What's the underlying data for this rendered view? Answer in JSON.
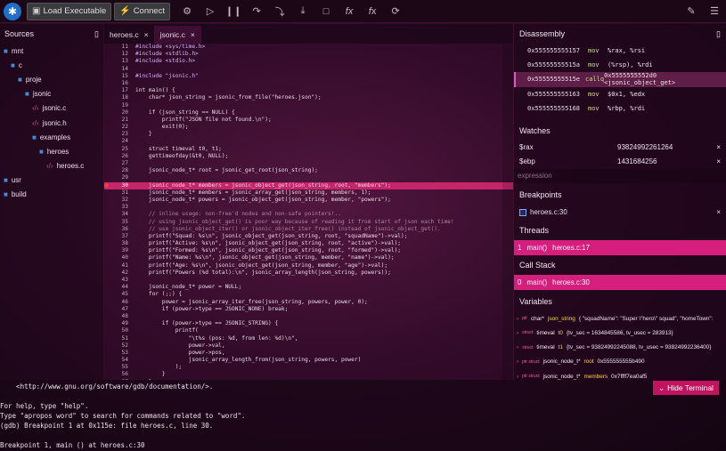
{
  "toolbar": {
    "load_label": "Load Executable",
    "connect_label": "Connect",
    "icons": [
      "cpu-icon",
      "play-icon",
      "pause-icon",
      "step-over-icon",
      "step-into-icon",
      "step-out-icon",
      "stop-icon",
      "function-icon",
      "function-alt-icon",
      "refresh-icon"
    ]
  },
  "sources": {
    "title": "Sources",
    "items": [
      {
        "label": "mnt",
        "kind": "folder",
        "depth": 0
      },
      {
        "label": "c",
        "kind": "folder",
        "depth": 1
      },
      {
        "label": "proje",
        "kind": "folder",
        "depth": 2
      },
      {
        "label": "jsonic",
        "kind": "folder",
        "depth": 3
      },
      {
        "label": "jsonic.c",
        "kind": "file",
        "depth": 4
      },
      {
        "label": "jsonic.h",
        "kind": "file",
        "depth": 4
      },
      {
        "label": "examples",
        "kind": "folder",
        "depth": 4
      },
      {
        "label": "heroes",
        "kind": "folder",
        "depth": 5
      },
      {
        "label": "heroes.c",
        "kind": "file",
        "depth": 6
      },
      {
        "label": "usr",
        "kind": "folder",
        "depth": 0
      },
      {
        "label": "build",
        "kind": "folder",
        "depth": 0
      }
    ]
  },
  "editor": {
    "tabs": [
      {
        "label": "heroes.c"
      },
      {
        "label": "jsonic.c"
      }
    ],
    "lines": [
      {
        "n": "11",
        "t": "#include <sys/time.h>"
      },
      {
        "n": "12",
        "t": "#include <stdlib.h>"
      },
      {
        "n": "13",
        "t": "#include <stdio.h>"
      },
      {
        "n": "14",
        "t": ""
      },
      {
        "n": "15",
        "t": "#include \"jsonic.h\""
      },
      {
        "n": "16",
        "t": ""
      },
      {
        "n": "17",
        "t": "int main() {"
      },
      {
        "n": "18",
        "t": "    char* json_string = jsonic_from_file(\"heroes.json\");"
      },
      {
        "n": "19",
        "t": ""
      },
      {
        "n": "20",
        "t": "    if (json_string == NULL) {"
      },
      {
        "n": "21",
        "t": "        printf(\"JSON file not found.\\n\");"
      },
      {
        "n": "22",
        "t": "        exit(0);"
      },
      {
        "n": "23",
        "t": "    }"
      },
      {
        "n": "24",
        "t": ""
      },
      {
        "n": "25",
        "t": "    struct timeval t0, t1;"
      },
      {
        "n": "26",
        "t": "    gettimeofday(&t0, NULL);"
      },
      {
        "n": "27",
        "t": ""
      },
      {
        "n": "28",
        "t": "    jsonic_node_t* root = jsonic_get_root(json_string);"
      },
      {
        "n": "29",
        "t": ""
      },
      {
        "n": "30",
        "t": "    jsonic_node_t* members = jsonic_object_get(json_string, root, \"members\");",
        "hl": true,
        "bp": true
      },
      {
        "n": "31",
        "t": "    jsonic_node_t* members = jsonic_array_get(json_string, members, 1);"
      },
      {
        "n": "32",
        "t": "    jsonic_node_t* powers = jsonic_object_get(json_string, member, \"powers\");"
      },
      {
        "n": "33",
        "t": ""
      },
      {
        "n": "34",
        "t": "    // inline usage: non-free'd nodes and non-safe pointers!.."
      },
      {
        "n": "35",
        "t": "    // using jsonic_object_get() is poor way because of reading it from start of json each time!"
      },
      {
        "n": "36",
        "t": "    // use jsonic_object_iter() or jsonic_object_iter_free() instead of jsonic_object_get()."
      },
      {
        "n": "37",
        "t": "    printf(\"Squad: %s\\n\", jsonic_object_get(json_string, root, \"squadName\")->val);"
      },
      {
        "n": "38",
        "t": "    printf(\"Active: %s\\n\", jsonic_object_get(json_string, root, \"active\")->val);"
      },
      {
        "n": "39",
        "t": "    printf(\"Formed: %s\\n\", jsonic_object_get(json_string, root, \"formed\")->val);"
      },
      {
        "n": "40",
        "t": "    printf(\"Name: %s\\n\", jsonic_object_get(json_string, member, \"name\")->val);"
      },
      {
        "n": "41",
        "t": "    printf(\"Age: %s\\n\", jsonic_object_get(json_string, member, \"age\")->val);"
      },
      {
        "n": "42",
        "t": "    printf(\"Powers (%d total):\\n\", jsonic_array_length(json_string, powers));"
      },
      {
        "n": "43",
        "t": ""
      },
      {
        "n": "44",
        "t": "    jsonic_node_t* power = NULL;"
      },
      {
        "n": "45",
        "t": "    for (;;) {"
      },
      {
        "n": "46",
        "t": "        power = jsonic_array_iter_free(json_string, powers, power, 0);"
      },
      {
        "n": "47",
        "t": "        if (power->type == JSONIC_NONE) break;"
      },
      {
        "n": "48",
        "t": ""
      },
      {
        "n": "49",
        "t": "        if (power->type == JSONIC_STRING) {"
      },
      {
        "n": "50",
        "t": "            printf("
      },
      {
        "n": "51",
        "t": "                \"\\t%s (pos: %d, from len: %d)\\n\","
      },
      {
        "n": "52",
        "t": "                power->val,"
      },
      {
        "n": "53",
        "t": "                power->pos,"
      },
      {
        "n": "54",
        "t": "                jsonic_array_length_from(json_string, powers, power)"
      },
      {
        "n": "55",
        "t": "            );"
      },
      {
        "n": "56",
        "t": "        }"
      },
      {
        "n": "57",
        "t": "    }"
      }
    ]
  },
  "terminal": {
    "lines": [
      "    <http://www.gnu.org/software/gdb/documentation/>.",
      "",
      "For help, type \"help\".",
      "Type \"apropos word\" to search for commands related to \"word\".",
      "(gdb) Breakpoint 1 at 0x115e: file heroes.c, line 30.",
      "",
      "Breakpoint 1, main () at heroes.c:30",
      "30          jsonic_node_t* members = jsonic_object_get(json_string, root, \"members\");"
    ],
    "hide_label": "Hide Terminal"
  },
  "disassembly": {
    "title": "Disassembly",
    "rows": [
      {
        "addr": "0x555555555157",
        "op": "mov",
        "args": "%rax, %rsi"
      },
      {
        "addr": "0x55555555515a",
        "op": "mov",
        "args": "(%rsp), %rdi"
      },
      {
        "addr": "0x55555555515e",
        "op": "callq",
        "args": "0x5555555552d0 <jsonic_object_get>",
        "current": true
      },
      {
        "addr": "0x555555555163",
        "op": "mov",
        "args": "$0x1, %edx"
      },
      {
        "addr": "0x555555555168",
        "op": "mov",
        "args": "%rbp, %rdi"
      }
    ]
  },
  "watches": {
    "title": "Watches",
    "rows": [
      {
        "name": "$rax",
        "value": "93824992261264"
      },
      {
        "name": "$ebp",
        "value": "1431684256"
      }
    ],
    "placeholder": "expression"
  },
  "breakpoints": {
    "title": "Breakpoints",
    "rows": [
      {
        "label": "heroes.c:30"
      }
    ]
  },
  "threads": {
    "title": "Threads",
    "rows": [
      {
        "id": "1",
        "func": "main()",
        "loc": "heroes.c:17"
      }
    ]
  },
  "callstack": {
    "title": "Call Stack",
    "rows": [
      {
        "id": "0",
        "func": "main()",
        "loc": "heroes.c:30"
      }
    ]
  },
  "variables": {
    "title": "Variables",
    "rows": [
      {
        "tag": "ptr",
        "type": "char*",
        "name": "json_string",
        "value": "{ \"squadName\": \"Super \\\"hero\\\" squad\", \"homeTown\":"
      },
      {
        "tag": "struct",
        "type": "timeval",
        "name": "t0",
        "value": "{tv_sec = 1634845586, tv_usec = 283913}"
      },
      {
        "tag": "struct",
        "type": "timeval",
        "name": "t1",
        "value": "{tv_sec = 93824992245088, tv_usec = 93824992236400}"
      },
      {
        "tag": "ptr struct",
        "type": "jsonic_node_t*",
        "name": "root",
        "value": "0x555555555b490"
      },
      {
        "tag": "ptr struct",
        "type": "jsonic_node_t*",
        "name": "members",
        "value": "0x7ffff7ea0af5"
      }
    ]
  }
}
